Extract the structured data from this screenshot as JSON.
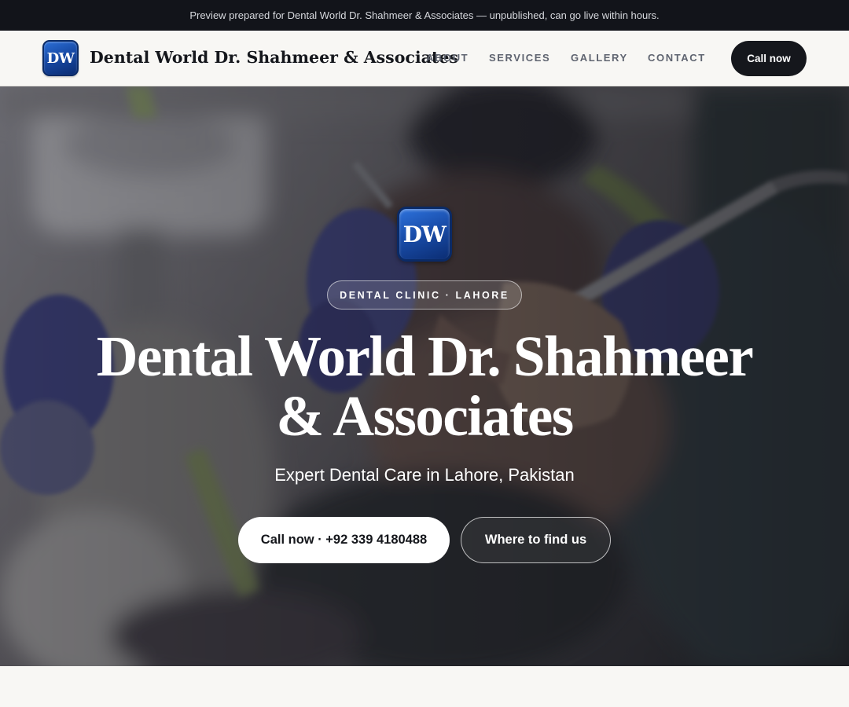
{
  "preview_banner": "Preview prepared for Dental World Dr. Shahmeer & Associates — unpublished, can go live within hours.",
  "header": {
    "logo_text": "DW",
    "brand_name": "Dental World Dr. Shahmeer & Associates",
    "nav": [
      "ABOUT",
      "SERVICES",
      "GALLERY",
      "CONTACT"
    ],
    "cta_label": "Call now"
  },
  "hero": {
    "logo_text": "DW",
    "badge": "DENTAL CLINIC · LAHORE",
    "title_line1": "Dental World Dr. Shahmeer",
    "title_line2": "& Associates",
    "subtitle": "Expert Dental Care in Lahore, Pakistan",
    "primary_button": "Call now · +92 339 4180488",
    "secondary_button": "Where to find us"
  },
  "colors": {
    "brand_blue": "#1a4eab",
    "dark": "#15171c",
    "background": "#f8f7f4"
  }
}
